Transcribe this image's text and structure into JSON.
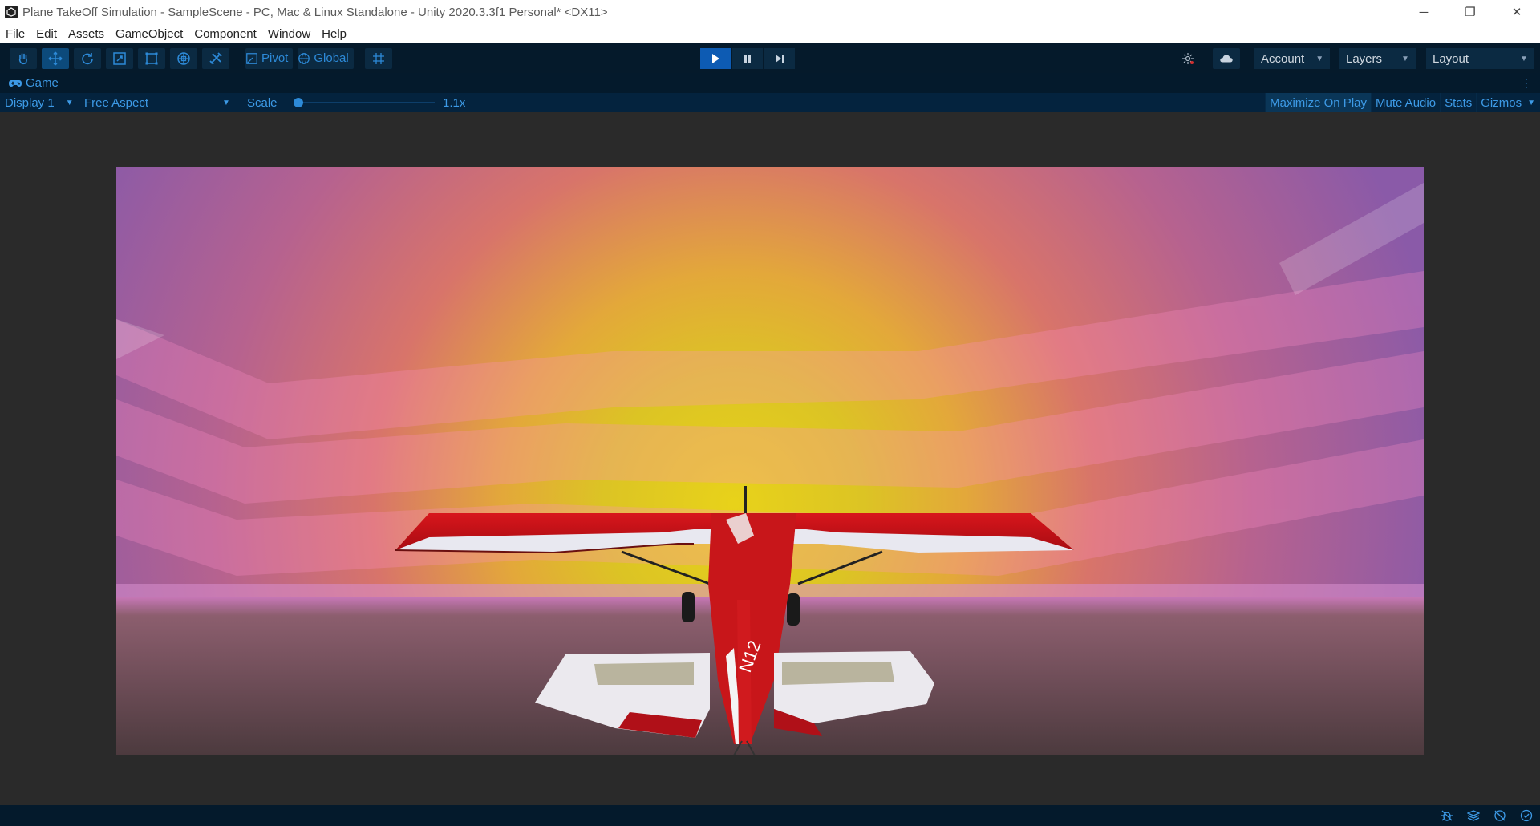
{
  "window": {
    "title": "Plane TakeOff Simulation - SampleScene - PC, Mac & Linux Standalone - Unity 2020.3.3f1 Personal* <DX11>",
    "controls": {
      "minimize": "─",
      "restore": "❐",
      "close": "✕"
    }
  },
  "menu": [
    "File",
    "Edit",
    "Assets",
    "GameObject",
    "Component",
    "Window",
    "Help"
  ],
  "toolbar": {
    "pivot_label": "Pivot",
    "global_label": "Global",
    "account_label": "Account",
    "layers_label": "Layers",
    "layout_label": "Layout",
    "caret": "▼"
  },
  "game_tab": {
    "label": "Game",
    "display": "Display 1",
    "aspect": "Free Aspect",
    "scale_label": "Scale",
    "scale_value": "1.1x",
    "maximize_on_play": "Maximize On Play",
    "mute_audio": "Mute Audio",
    "stats": "Stats",
    "gizmos": "Gizmos",
    "more": "⋮"
  },
  "colors": {
    "accent": "#2d8ad8",
    "toolbar_bg": "#051a2b",
    "play_active": "#0d5bb3",
    "plane_red": "#c8161a"
  },
  "icons": [
    "hand-tool-icon",
    "move-tool-icon",
    "rotate-tool-icon",
    "scale-tool-icon",
    "rect-tool-icon",
    "transform-tool-icon",
    "custom-tool-icon",
    "pivot-icon",
    "global-icon",
    "grid-snap-icon",
    "play-icon",
    "pause-icon",
    "step-icon",
    "collab-icon",
    "cloud-icon",
    "game-controller-icon"
  ]
}
